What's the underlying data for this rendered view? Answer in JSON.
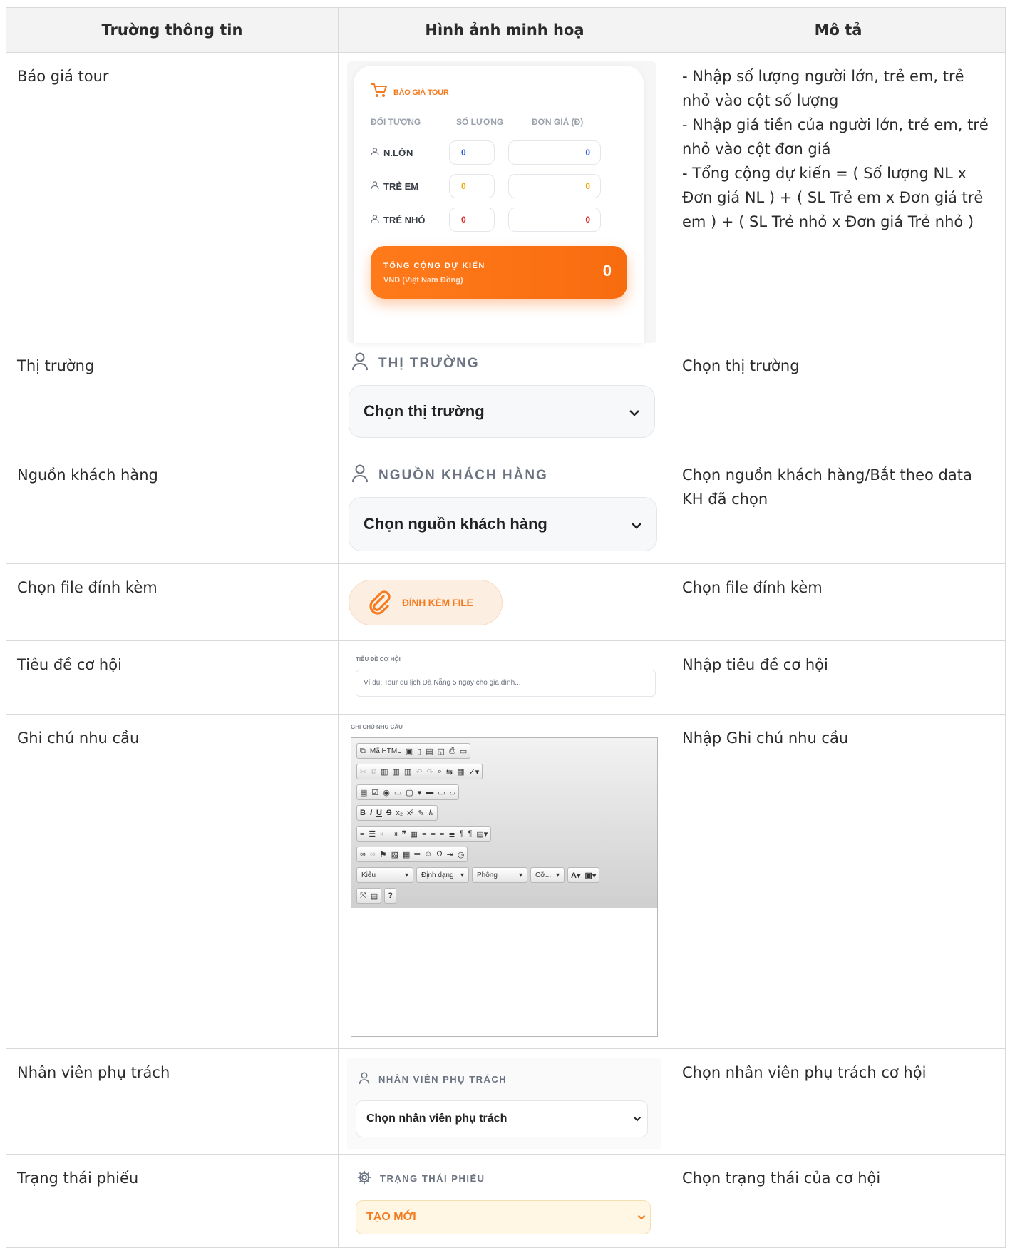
{
  "headers": [
    "Trường thông tin",
    "Hình ảnh minh hoạ",
    "Mô tả"
  ],
  "rows": [
    {
      "field": "Báo giá tour",
      "desc": [
        "- Nhập số lượng người lớn, trẻ em, trẻ nhỏ vào cột số lượng",
        "- Nhập giá tiền của người lớn, trẻ em, trẻ nhỏ vào cột đơn giá",
        "- Tổng cộng dự kiến = ( Số lượng NL x Đơn giá NL ) + ( SL Trẻ em x Đơn giá trẻ em ) + ( SL Trẻ nhỏ x Đơn giá Trẻ nhỏ )"
      ]
    },
    {
      "field": "Thị trường",
      "desc": [
        "Chọn thị trường"
      ]
    },
    {
      "field": "Nguồn khách hàng",
      "desc": [
        "Chọn nguồn khách hàng/Bắt theo data KH đã chọn"
      ]
    },
    {
      "field": "Chọn file đính kèm",
      "desc": [
        "Chọn file đính kèm"
      ]
    },
    {
      "field": "Tiêu đề cơ hội",
      "desc": [
        "Nhập tiêu đề cơ hội"
      ]
    },
    {
      "field": "Ghi chú nhu cầu",
      "desc": [
        "Nhập Ghi chú nhu cầu"
      ]
    },
    {
      "field": "Nhân viên phụ trách",
      "desc": [
        "Chọn nhân viên phụ trách cơ hội"
      ]
    },
    {
      "field": "Trạng thái phiếu",
      "desc": [
        "Chọn trạng thái của cơ hội"
      ]
    }
  ],
  "quote": {
    "title": "BÁO GIÁ TOUR",
    "col_subject": "ĐỐI TƯỢNG",
    "col_qty": "SỐ LƯỢNG",
    "col_price": "ĐƠN GIÁ (Đ)",
    "lines": [
      {
        "label": "N.LỚN",
        "qty": "0",
        "price": "0",
        "color": "#2f5fd6"
      },
      {
        "label": "TRẺ EM",
        "qty": "0",
        "price": "0",
        "color": "#f0a500"
      },
      {
        "label": "TRẺ NHỎ",
        "qty": "0",
        "price": "0",
        "color": "#e02424"
      }
    ],
    "total_label": "TỔNG CỘNG DỰ KIẾN",
    "total_unit": "VND (Việt Nam Đồng)",
    "total_value": "0",
    "accent": "#f47b20"
  },
  "market": {
    "label": "THỊ TRƯỜNG",
    "placeholder": "Chọn thị trường",
    "icon": "user-icon"
  },
  "source": {
    "label": "NGUỒN KHÁCH HÀNG",
    "placeholder": "Chọn nguồn khách hàng",
    "icon": "user-icon"
  },
  "attach": {
    "label": "ĐÍNH KÈM FILE",
    "icon": "paperclip-icon"
  },
  "title_input": {
    "label": "TIÊU ĐỀ CƠ HỘI",
    "placeholder": "Ví dụ: Tour du lịch Đà Nẵng 5 ngày cho gia đình..."
  },
  "note_editor": {
    "label": "GHI CHÚ NHU CẦU",
    "source_button": "Mã HTML",
    "combo_style": "Kiểu",
    "combo_format": "Định dạng",
    "combo_font": "Phông",
    "combo_size": "Cỡ..."
  },
  "staff": {
    "label": "NHÂN VIÊN PHỤ TRÁCH",
    "placeholder": "Chọn nhân viên phụ trách",
    "icon": "user-icon"
  },
  "status": {
    "label": "TRẠNG THÁI PHIẾU",
    "value": "TẠO MỚI",
    "icon": "gear-icon"
  }
}
